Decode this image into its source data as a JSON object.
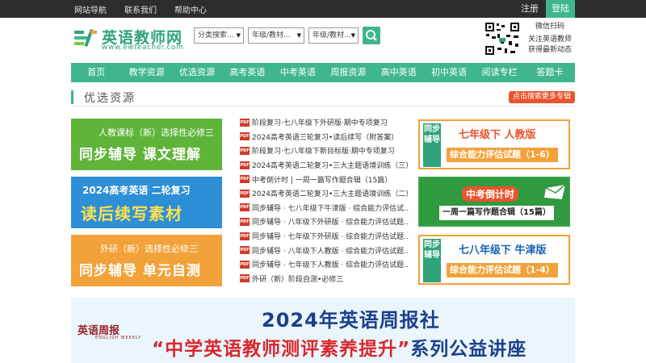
{
  "topbar": {
    "links": [
      "网站导航",
      "联系我们",
      "帮助中心"
    ],
    "register": "注册",
    "login": "登陆"
  },
  "logo": {
    "cn": "英语教师网",
    "en": "www.ewteacher.com"
  },
  "search": {
    "category": "分类搜索...",
    "grade1": "年级/教材...",
    "grade2": "年级/教材...",
    "search_icon": "search-icon"
  },
  "qr": {
    "title": "微信扫码",
    "line1": "关注英语教师",
    "line2": "获得最新动态"
  },
  "nav": [
    "首页",
    "教学资源",
    "优选资源",
    "高考英语",
    "中考英语",
    "周报资源",
    "高中英语",
    "初中英语",
    "阅读专栏",
    "答题卡"
  ],
  "section": {
    "title": "优选资源",
    "more": "点击搜索更多专辑"
  },
  "left_banners": [
    {
      "t1": "人教课标（新）选择性必修三",
      "t2": "同步辅导 课文理解"
    },
    {
      "t1": "2024高考英语 二轮复习",
      "t2": "读后续写素材"
    },
    {
      "t1": "外研（新）选择性必修三",
      "t2": "同步辅导 单元自测"
    }
  ],
  "list": [
    "阶段复习·七八年级下外研版·期中专项复习",
    "2024高考英语三轮复习•读后续写（附答案）",
    "阶段复习·七八年级下新目标版·期中专项复习",
    "2024高考英语二轮复习•三大主题语境训练（三）",
    "中考倒计时 | 一周一篇写作题合辑（15篇）",
    "2024高考英语二轮复习•三大主题语境训练（二）",
    "同步辅导 · 七八年级下牛津版 · 综合能力评估试...",
    "同步辅导 · 八年级下外研版 · 综合能力评估试题...",
    "同步辅导 · 七年级下外研版 · 综合能力评估试题...",
    "同步辅导 · 八年级下人教版 · 综合能力评估试题...",
    "同步辅导 · 七年级下人教版 · 综合能力评估试题...",
    "外研（新）阶段自测•必修三"
  ],
  "pdf_label": "PDF",
  "right_banners": [
    {
      "vert": "同步辅导",
      "rt1": "七年级下 人教版",
      "rt2": "综合能力评估试题（1-6）"
    },
    {
      "vert": "",
      "rt1": "中考倒计时",
      "rt2": "一周一篇写作题合辑（15篇）"
    },
    {
      "vert": "同步辅导",
      "rt1": "七八年级下 牛津版",
      "rt2": "综合能力评估试题（1-4）"
    }
  ],
  "bottom_banner": {
    "publisher": "英语周报",
    "publisher_en": "ENGLISH WEEKLY",
    "line1": "2024年英语周报社",
    "line2_hl": "“中学英语教师测评素养提升”",
    "line2_rest": "系列公益讲座"
  },
  "colors": {
    "brand_green": "#3fb68f",
    "topbar": "#2d2d2d",
    "accent_orange": "#e8542d",
    "banner_blue": "#1c3f8c"
  }
}
